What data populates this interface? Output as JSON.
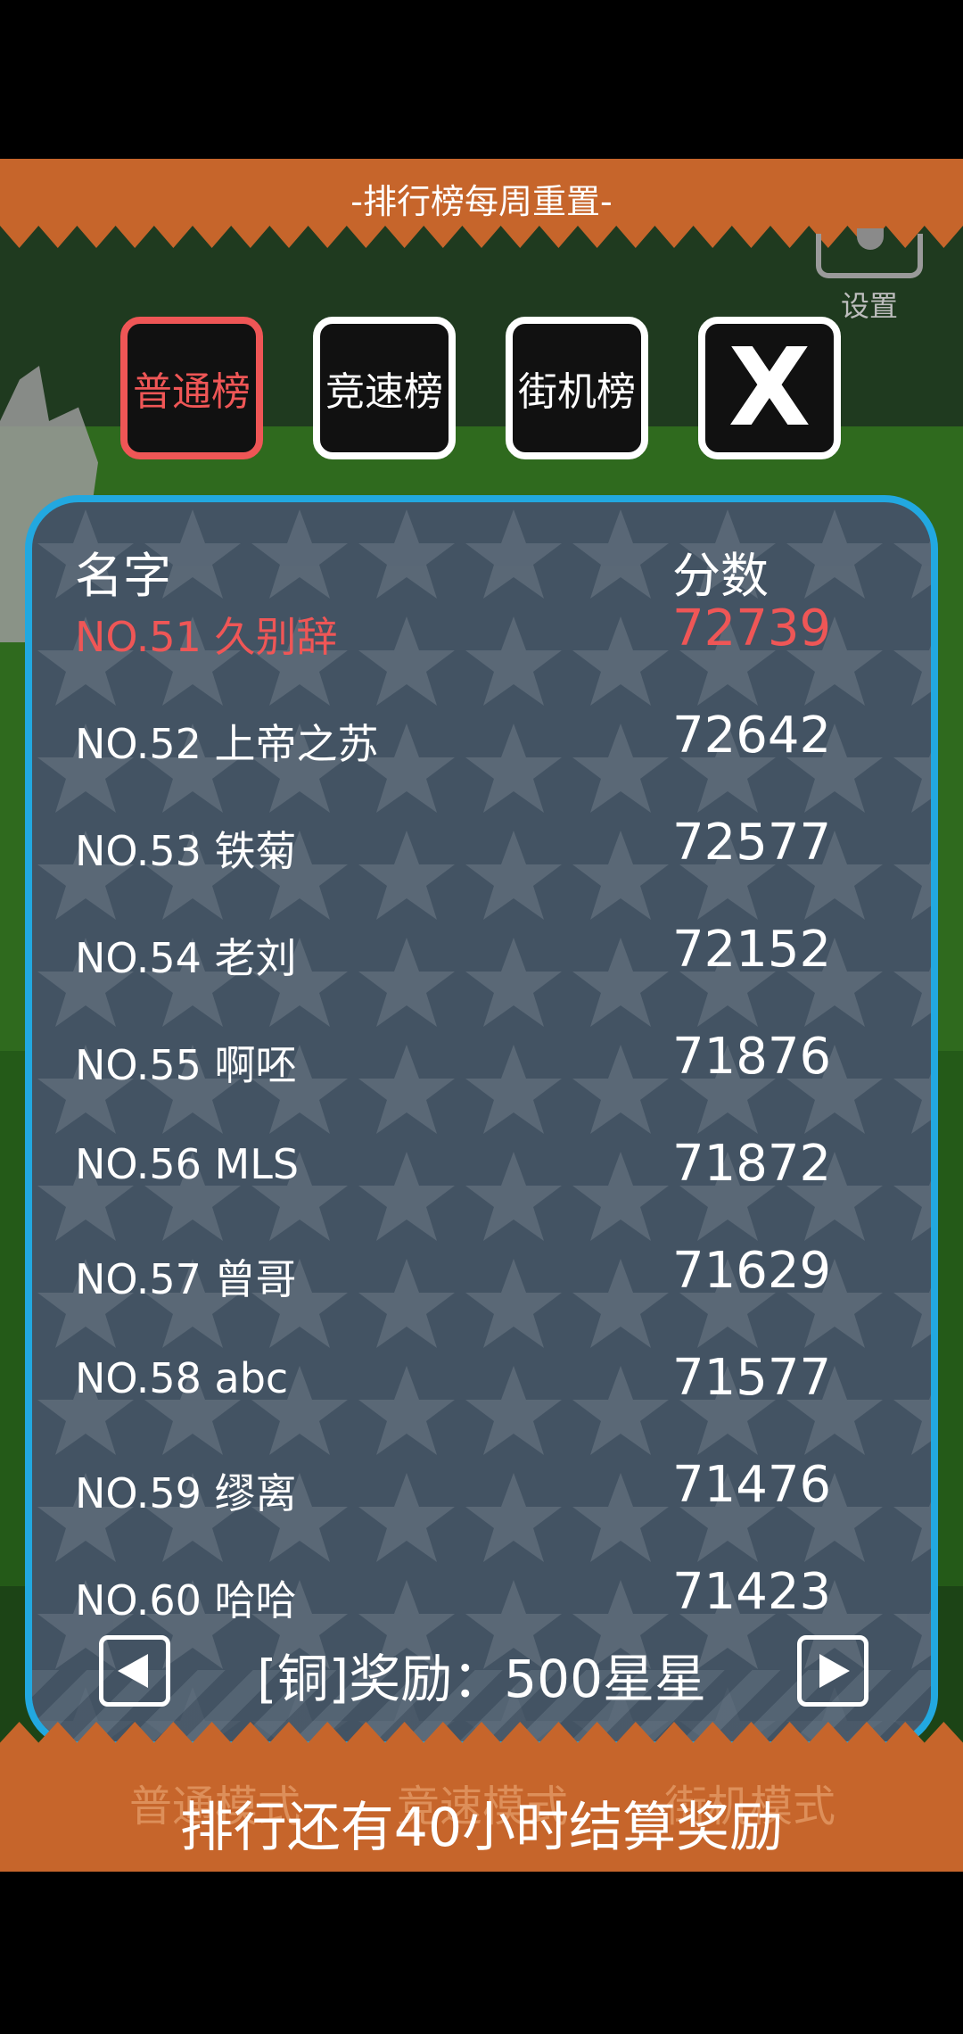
{
  "banner": {
    "title": "-排行榜每周重置-"
  },
  "settings": {
    "label": "设置"
  },
  "tabs": [
    {
      "label": "普通榜",
      "active": true
    },
    {
      "label": "竞速榜",
      "active": false
    },
    {
      "label": "街机榜",
      "active": false
    }
  ],
  "close_label": "X",
  "table": {
    "headers": {
      "name": "名字",
      "score": "分数"
    },
    "rows": [
      {
        "rank": "NO.51 久别辞",
        "score": "72739",
        "highlight": true
      },
      {
        "rank": "NO.52 上帝之苏",
        "score": "72642"
      },
      {
        "rank": "NO.53 铁菊",
        "score": "72577"
      },
      {
        "rank": "NO.54 老刘",
        "score": "72152"
      },
      {
        "rank": "NO.55 啊呸",
        "score": "71876"
      },
      {
        "rank": "NO.56 MLS",
        "score": "71872"
      },
      {
        "rank": "NO.57 曾哥",
        "score": "71629"
      },
      {
        "rank": "NO.58 abc",
        "score": "71577"
      },
      {
        "rank": "NO.59 缪离",
        "score": "71476"
      },
      {
        "rank": "NO.60 哈哈",
        "score": "71423"
      }
    ]
  },
  "reward": "[铜]奖励：500星星",
  "bottom_message": "排行还有40小时结算奖励",
  "background_labels": [
    "普通模式",
    "竞速模式",
    "街机模式"
  ],
  "colors": {
    "accent_red": "#ef5656",
    "panel_border": "#22a8e0",
    "banner": "#c6652b"
  }
}
